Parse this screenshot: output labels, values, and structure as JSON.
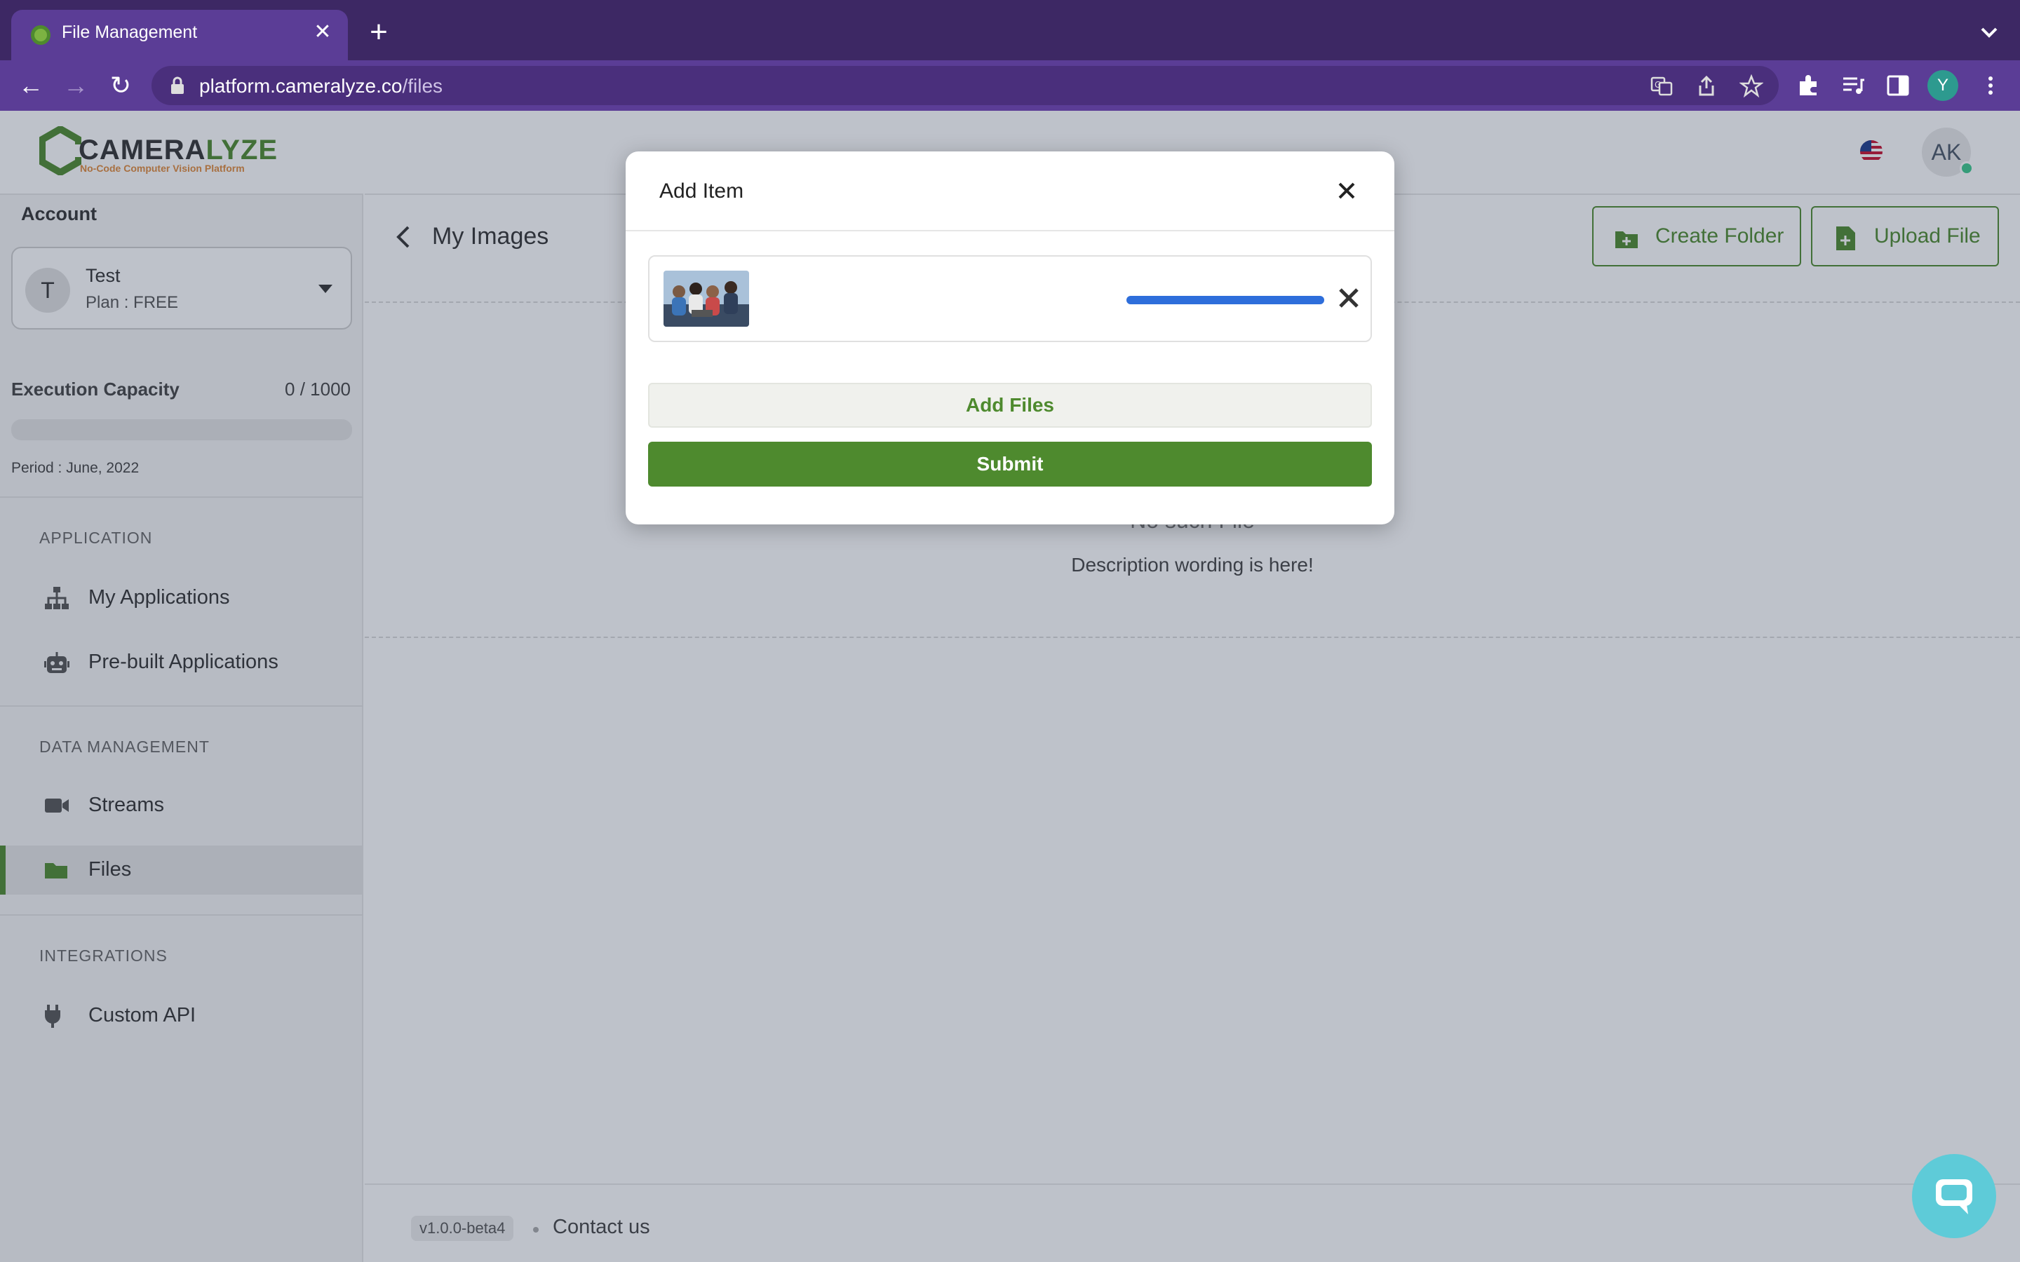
{
  "browser": {
    "tab_title": "File Management",
    "url_host": "platform.cameralyze.co",
    "url_path": "/files",
    "profile_initial": "Y"
  },
  "sidebar": {
    "logo_text_a": "CAMERA",
    "logo_text_b": "LYZE",
    "logo_subtitle": "No-Code Computer Vision Platform",
    "account_label": "Account",
    "account": {
      "initial": "T",
      "name": "Test",
      "plan": "Plan : FREE"
    },
    "capacity": {
      "label": "Execution Capacity",
      "value": "0 / 1000",
      "fraction": 0.0,
      "period": "Period : June, 2022"
    },
    "sections": [
      {
        "title": "APPLICATION",
        "items": [
          {
            "label": "My Applications",
            "icon": "sitemap-icon"
          },
          {
            "label": "Pre-built Applications",
            "icon": "robot-icon"
          }
        ]
      },
      {
        "title": "DATA MANAGEMENT",
        "items": [
          {
            "label": "Streams",
            "icon": "video-camera-icon"
          },
          {
            "label": "Files",
            "icon": "folder-icon",
            "active": true
          }
        ]
      },
      {
        "title": "INTEGRATIONS",
        "items": [
          {
            "label": "Custom API",
            "icon": "plug-icon"
          }
        ]
      }
    ]
  },
  "header": {
    "user_initials": "AK"
  },
  "page": {
    "title": "My Images",
    "create_folder_label": "Create Folder",
    "upload_file_label": "Upload File",
    "empty_title": "No such File",
    "empty_description": "Description wording is here!"
  },
  "footer": {
    "version": "v1.0.0-beta4",
    "contact": "Contact us"
  },
  "modal": {
    "title": "Add Item",
    "upload_progress": 1.0,
    "add_files_label": "Add Files",
    "submit_label": "Submit"
  },
  "colors": {
    "accent": "#4e8a2e",
    "browser": "#5b3d96",
    "progress": "#2e6edb"
  }
}
